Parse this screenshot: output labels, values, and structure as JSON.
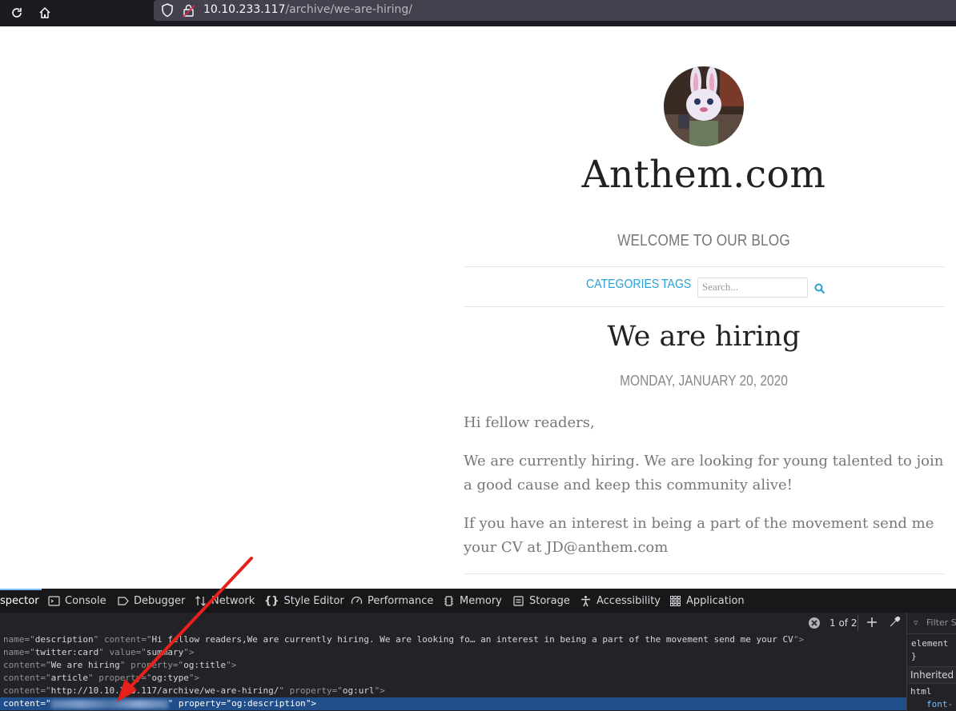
{
  "browser": {
    "url_host": "10.10.233.117",
    "url_path": "/archive/we-are-hiring/"
  },
  "site": {
    "title": "Anthem.com",
    "tagline": "WELCOME TO OUR BLOG",
    "nav": {
      "categories": "CATEGORIES",
      "tags": "TAGS"
    },
    "search_placeholder": "Search..."
  },
  "post": {
    "title": "We are hiring",
    "date": "MONDAY, JANUARY 20, 2020",
    "paragraphs": [
      "Hi fellow readers,",
      "We are currently hiring. We are looking for young talented to join a good cause and keep this community alive!",
      "If you have an interest in being a part of the movement send me your CV at JD@anthem.com"
    ]
  },
  "devtools": {
    "tabs": [
      "spector",
      "Console",
      "Debugger",
      "Network",
      "Style Editor",
      "Performance",
      "Memory",
      "Storage",
      "Accessibility",
      "Application"
    ],
    "search_count": "1 of 2",
    "filter_placeholder": "Filter S",
    "lines": [
      {
        "a1": "name=\"",
        "v1": "description",
        "a2": "\" content=\"",
        "v2": "Hi fellow readers,We are currently hiring. We are looking fo… an interest in being a part of the movement send me your CV",
        "a3": "\">"
      },
      {
        "a1": "name=\"",
        "v1": "twitter:card",
        "a2": "\" value=\"",
        "v2": "summary",
        "a3": "\">"
      },
      {
        "a1": "content=\"",
        "v1": "We are hiring",
        "a2": "\" property=\"",
        "v2": "og:title",
        "a3": "\">"
      },
      {
        "a1": "content=\"",
        "v1": "article",
        "a2": "\" property=\"",
        "v2": "og:type",
        "a3": "\">"
      },
      {
        "a1": "content=\"",
        "v1": "http://10.10.233.117/archive/we-are-hiring/",
        "a2": "\" property=\"",
        "v2": "og:url",
        "a3": "\">"
      }
    ],
    "selected_line": {
      "a1": "content=\"",
      "a2": "\" property=\"",
      "v2": "og:description",
      "a3": "\">"
    },
    "side": {
      "rule": "element",
      "close": "}",
      "inherited": "Inherited",
      "html": "html",
      "font": "font-"
    }
  }
}
